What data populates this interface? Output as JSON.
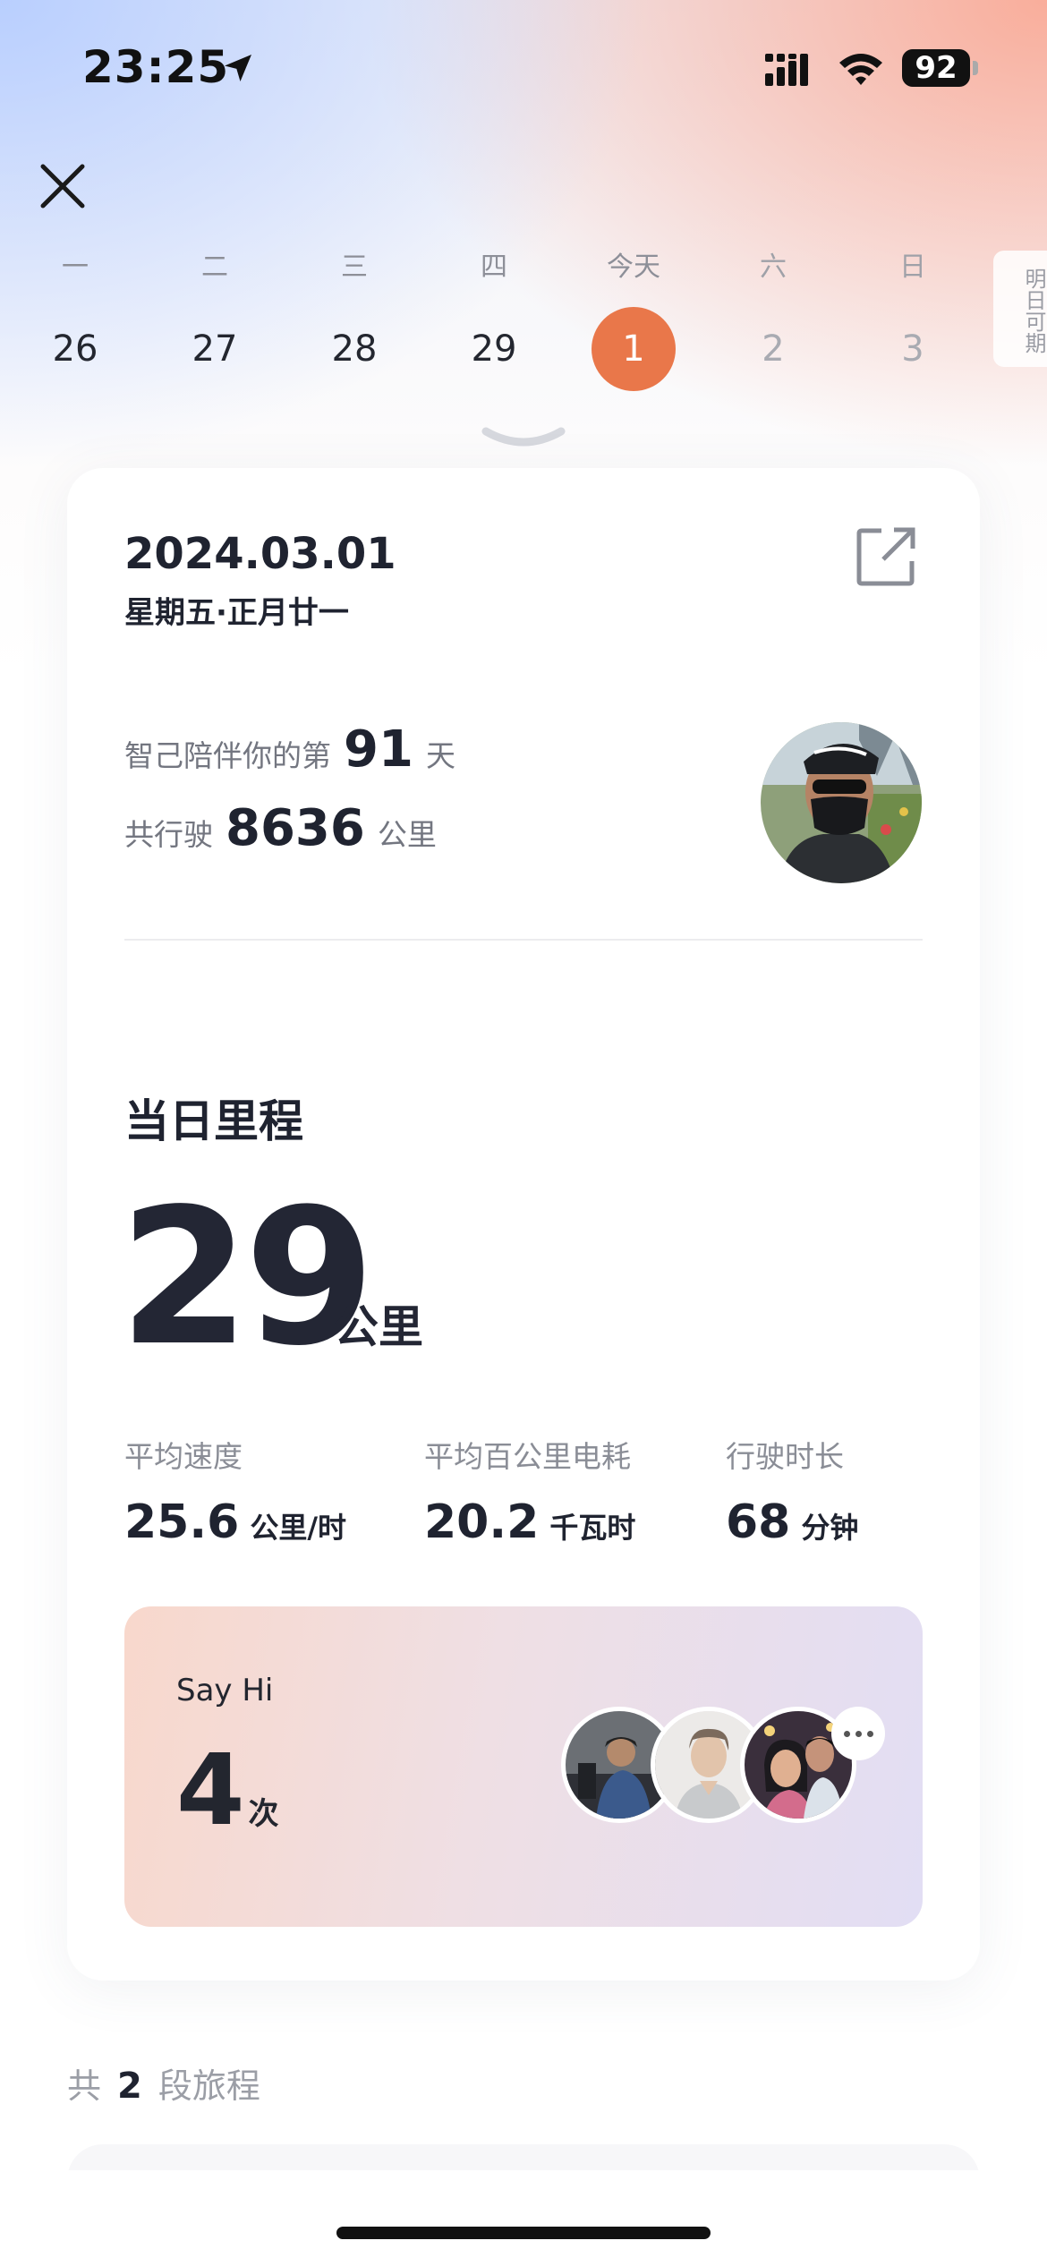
{
  "status_bar": {
    "time": "23:25",
    "battery": "92"
  },
  "week": {
    "days": [
      {
        "label": "一",
        "num": "26"
      },
      {
        "label": "二",
        "num": "27"
      },
      {
        "label": "三",
        "num": "28"
      },
      {
        "label": "四",
        "num": "29"
      },
      {
        "label": "今天",
        "num": "1"
      },
      {
        "label": "六",
        "num": "2"
      },
      {
        "label": "日",
        "num": "3"
      }
    ],
    "tomorrow_hint": "明日可期"
  },
  "card": {
    "date": "2024.03.01",
    "date_sub": "星期五·正月廿一",
    "companion_prefix": "智己陪伴你的第",
    "companion_days": "91",
    "companion_suffix": "天",
    "total_prefix": "共行驶",
    "total_km": "8636",
    "total_unit": "公里",
    "mileage_title": "当日里程",
    "mileage_value": "29",
    "mileage_unit": "公里",
    "stats": [
      {
        "label": "平均速度",
        "value": "25.6",
        "unit": "公里/时"
      },
      {
        "label": "平均百公里电耗",
        "value": "20.2",
        "unit": "千瓦时"
      },
      {
        "label": "行驶时长",
        "value": "68",
        "unit": "分钟"
      }
    ],
    "say_hi": {
      "title": "Say Hi",
      "count": "4",
      "unit": "次"
    }
  },
  "trips": {
    "prefix": "共",
    "count": "2",
    "suffix": "段旅程"
  },
  "colors": {
    "accent": "#e9774a",
    "text_primary": "#1f2330",
    "text_secondary": "#8a8d96"
  }
}
